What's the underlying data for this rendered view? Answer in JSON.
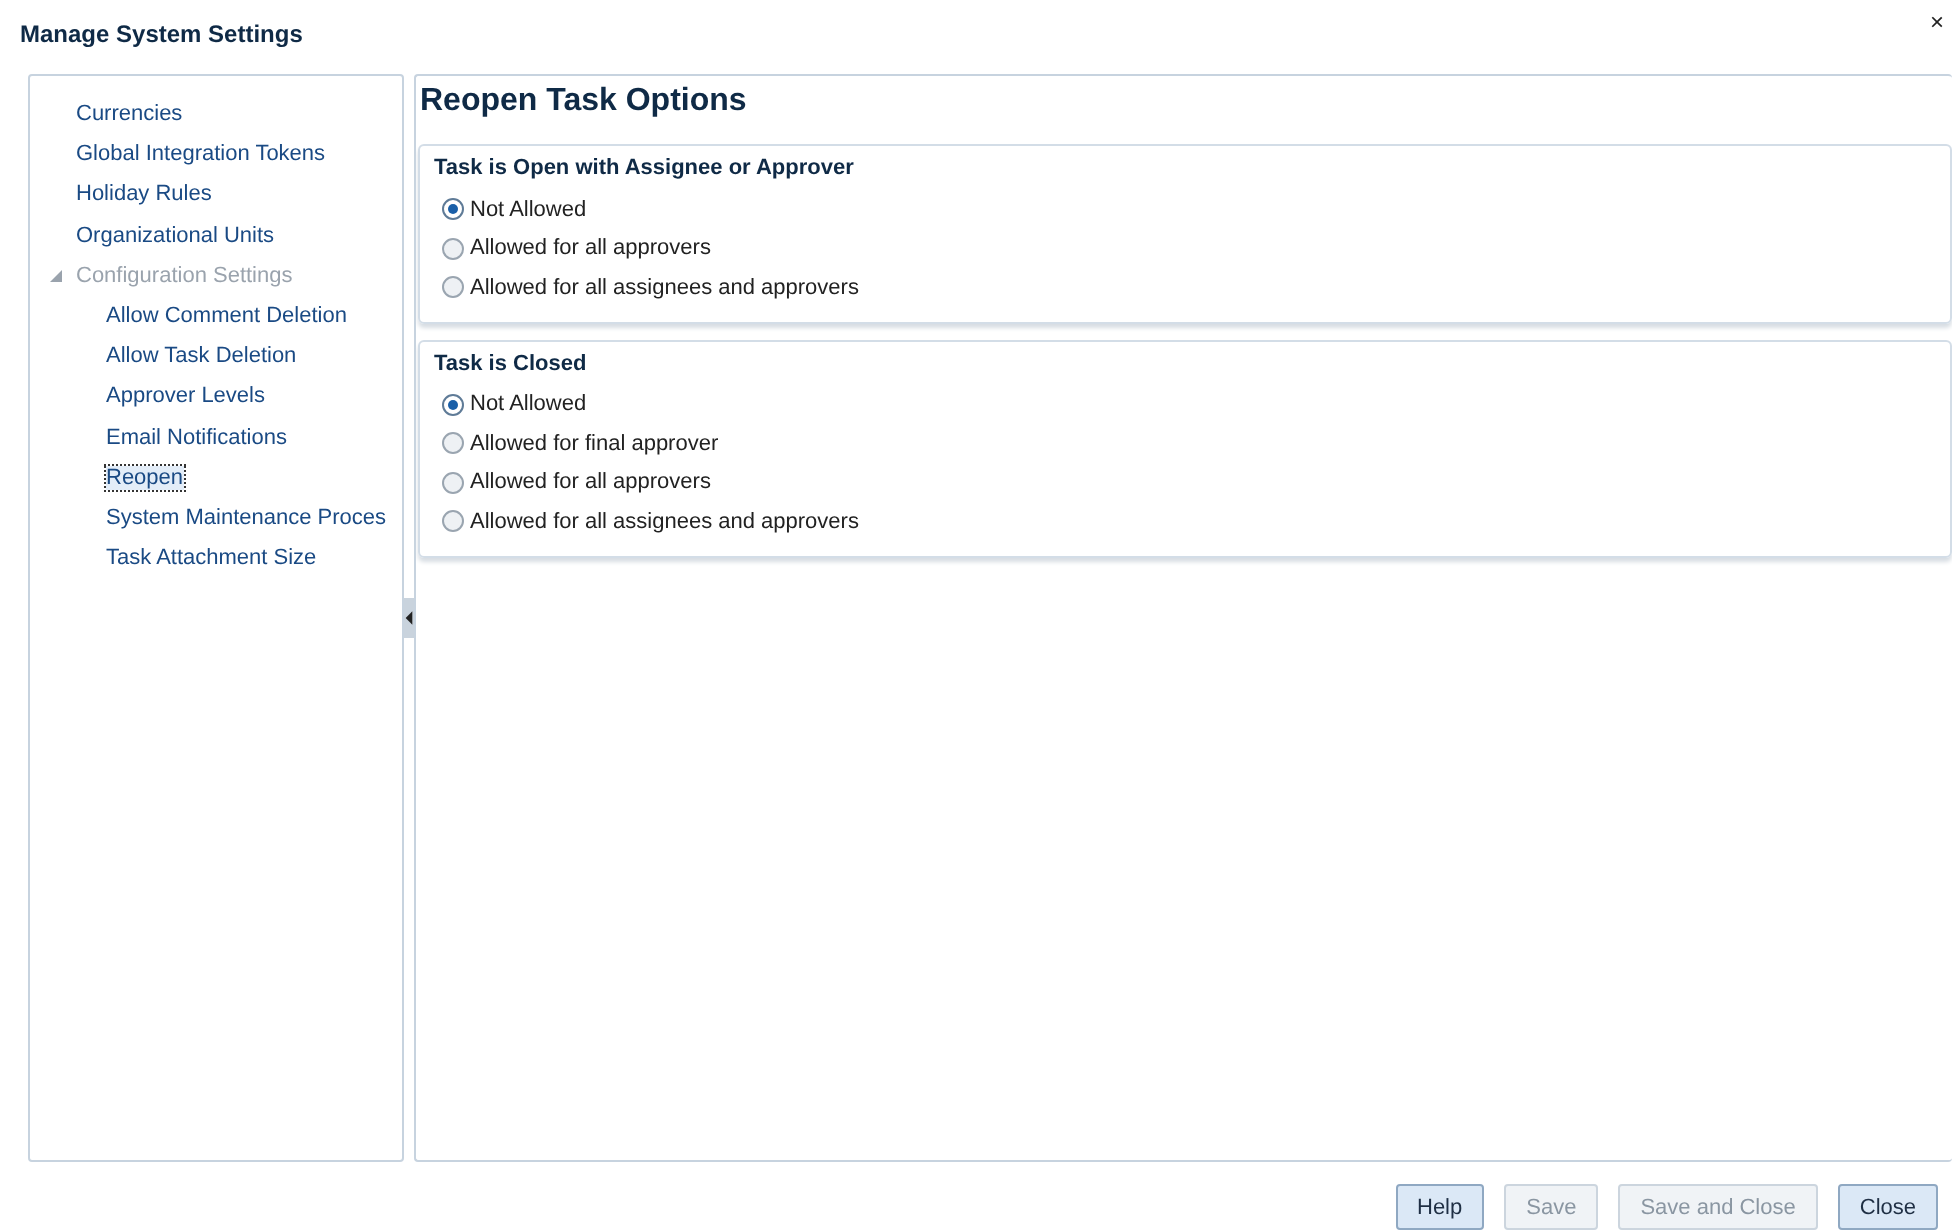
{
  "window": {
    "title": "Manage System Settings",
    "close": "×"
  },
  "sidebar": {
    "items": [
      {
        "label": "Currencies",
        "selected": false,
        "disabled": false
      },
      {
        "label": "Global Integration Tokens",
        "selected": false,
        "disabled": false
      },
      {
        "label": "Holiday Rules",
        "selected": false,
        "disabled": false
      },
      {
        "label": "Organizational Units",
        "selected": false,
        "disabled": false
      },
      {
        "label": "Configuration Settings",
        "selected": false,
        "disabled": true,
        "expanded": true,
        "children": [
          {
            "label": "Allow Comment Deletion",
            "selected": false,
            "disabled": false
          },
          {
            "label": "Allow Task Deletion",
            "selected": false,
            "disabled": false
          },
          {
            "label": "Approver Levels",
            "selected": false,
            "disabled": false
          },
          {
            "label": "Email Notifications",
            "selected": false,
            "disabled": false
          },
          {
            "label": "Reopen",
            "selected": true,
            "disabled": false
          },
          {
            "label": "System Maintenance Proces",
            "selected": false,
            "disabled": false
          },
          {
            "label": "Task Attachment Size",
            "selected": false,
            "disabled": false
          }
        ]
      }
    ]
  },
  "content": {
    "heading": "Reopen Task Options",
    "sections": [
      {
        "title": "Task is Open with Assignee or Approver",
        "options": [
          {
            "label": "Not Allowed",
            "selected": true
          },
          {
            "label": "Allowed for all approvers",
            "selected": false
          },
          {
            "label": "Allowed for all assignees and approvers",
            "selected": false
          }
        ]
      },
      {
        "title": "Task is Closed",
        "options": [
          {
            "label": "Not Allowed",
            "selected": true
          },
          {
            "label": "Allowed for final approver",
            "selected": false
          },
          {
            "label": "Allowed for all approvers",
            "selected": false
          },
          {
            "label": "Allowed for all assignees and approvers",
            "selected": false
          }
        ]
      }
    ]
  },
  "buttons": [
    {
      "label": "Help",
      "disabled": false
    },
    {
      "label": "Save",
      "disabled": true
    },
    {
      "label": "Save and Close",
      "disabled": true
    },
    {
      "label": "Close",
      "disabled": false
    }
  ]
}
